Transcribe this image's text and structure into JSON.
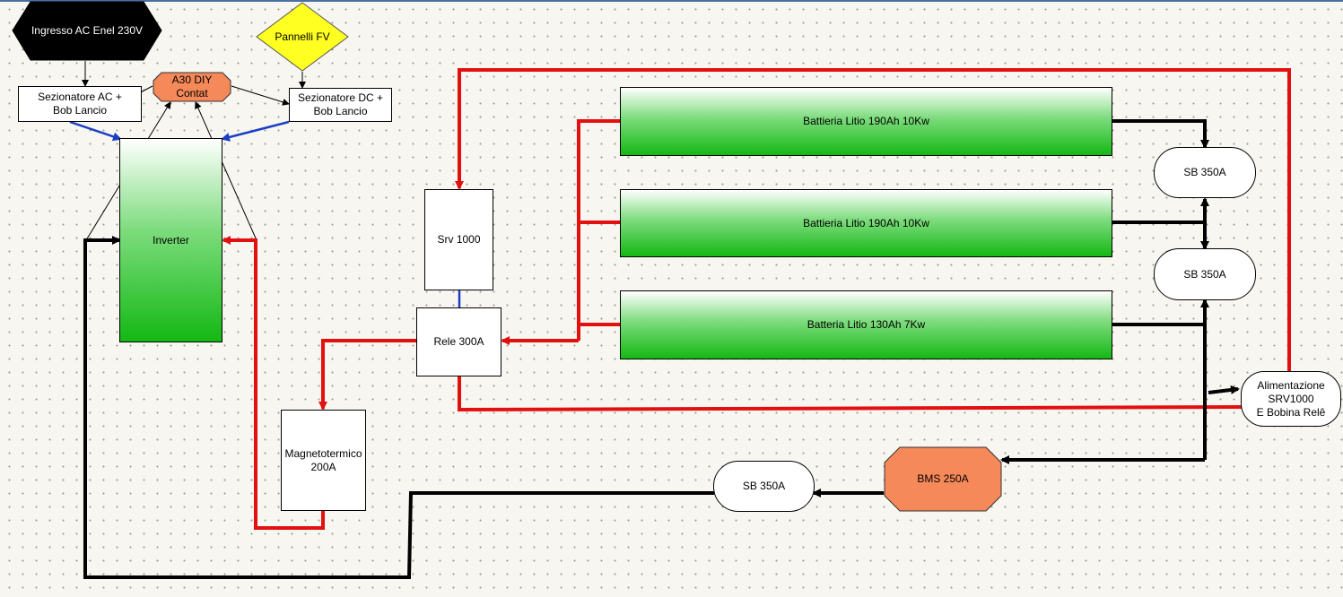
{
  "diagram": {
    "nodes": {
      "ingresso_ac": "Ingresso AC Enel 230V",
      "pannelli_fv": "Pannelli FV",
      "a30": "A30 DIY\nContat",
      "sez_ac": "Sezionatore AC +\nBob Lancio",
      "sez_dc": "Sezionatore DC +\nBob Lancio",
      "inverter": "Inverter",
      "srv": "Srv 1000",
      "rele": "Rele 300A",
      "magneto": "Magnetotermico\n200A",
      "batt1": "Battieria Litio 190Ah 10Kw",
      "batt2": "Battieria Litio 190Ah 10Kw",
      "batt3": "Batteria Litio 130Ah 7Kw",
      "sb1": "SB 350A",
      "sb2": "SB 350A",
      "sb3": "SB 350A",
      "bms": "BMS 250A",
      "alimentazione": "Alimentazione\nSRV1000\nE Bobina Relê"
    },
    "colors": {
      "dc_positive": "#e31010",
      "dc_negative": "#000000",
      "link_blue": "#1a3fc4",
      "battery_green": "#14b814",
      "orange_node": "#f5895a",
      "fv_yellow": "#ffff22"
    }
  }
}
